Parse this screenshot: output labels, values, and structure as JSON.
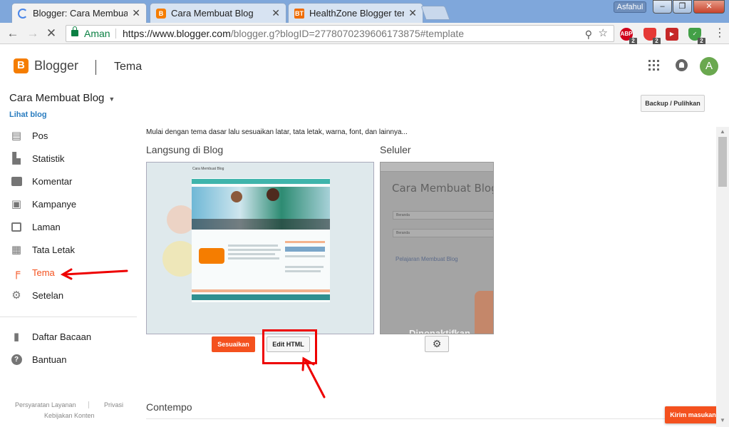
{
  "browser": {
    "tabs": [
      {
        "title": "Blogger: Cara Membuat B",
        "favicon": "loading-spinner",
        "active": true
      },
      {
        "title": "Cara Membuat Blog",
        "favicon": "blogger-icon",
        "active": false
      },
      {
        "title": "HealthZone Blogger tem",
        "favicon": "bt-icon",
        "active": false
      }
    ],
    "profile_name": "Asfahul",
    "secure_label": "Aman",
    "url_host": "https://www.blogger.com",
    "url_path": "/blogger.g?blogID=2778070239606173875#template",
    "extensions": [
      {
        "label": "ABP",
        "badge": "2",
        "color": "#d0021b"
      },
      {
        "label": "",
        "badge": "2",
        "color": "#e53935"
      },
      {
        "label": "",
        "badge": "",
        "color": "#c62828"
      },
      {
        "label": "",
        "badge": "2",
        "color": "#43a047"
      }
    ]
  },
  "header": {
    "brand": "Blogger",
    "title": "Tema",
    "avatar_letter": "A"
  },
  "sidebar": {
    "blog_name": "Cara Membuat Blog",
    "view_blog": "Lihat blog",
    "items": [
      {
        "label": "Pos",
        "icon": "posts-icon"
      },
      {
        "label": "Statistik",
        "icon": "stats-icon"
      },
      {
        "label": "Komentar",
        "icon": "comment-icon"
      },
      {
        "label": "Kampanye",
        "icon": "campaign-icon"
      },
      {
        "label": "Laman",
        "icon": "pages-icon"
      },
      {
        "label": "Tata Letak",
        "icon": "layout-icon"
      },
      {
        "label": "Tema",
        "icon": "theme-icon",
        "active": true
      },
      {
        "label": "Setelan",
        "icon": "gear-icon"
      }
    ],
    "items2": [
      {
        "label": "Daftar Bacaan",
        "icon": "bookmark-icon"
      },
      {
        "label": "Bantuan",
        "icon": "help-icon"
      }
    ],
    "footer": {
      "terms": "Persyaratan Layanan",
      "privacy": "Privasi",
      "content_policy": "Kebijakan Konten"
    }
  },
  "main": {
    "backup_button": "Backup / Pulihkan",
    "intro": "Mulai dengan tema dasar lalu sesuaikan latar, tata letak, warna, font, dan lainnya...",
    "live_label": "Langsung di Blog",
    "mobile_label": "Seluler",
    "live_preview_title": "Cara Membuat Blog",
    "mobile_preview": {
      "blog_title": "Cara Membuat Blog",
      "field1": "Beranda",
      "field2": "Beranda",
      "link": "Pelajaran Membuat Blog",
      "overlay": "Dinonaktifkan"
    },
    "customize_button": "Sesuaikan",
    "edit_html_button": "Edit HTML",
    "contempo_label": "Contempo",
    "feedback_button": "Kirim masukan"
  },
  "colors": {
    "accent": "#f4511e",
    "link": "#2a7dc0",
    "annotation": "#e00000"
  }
}
